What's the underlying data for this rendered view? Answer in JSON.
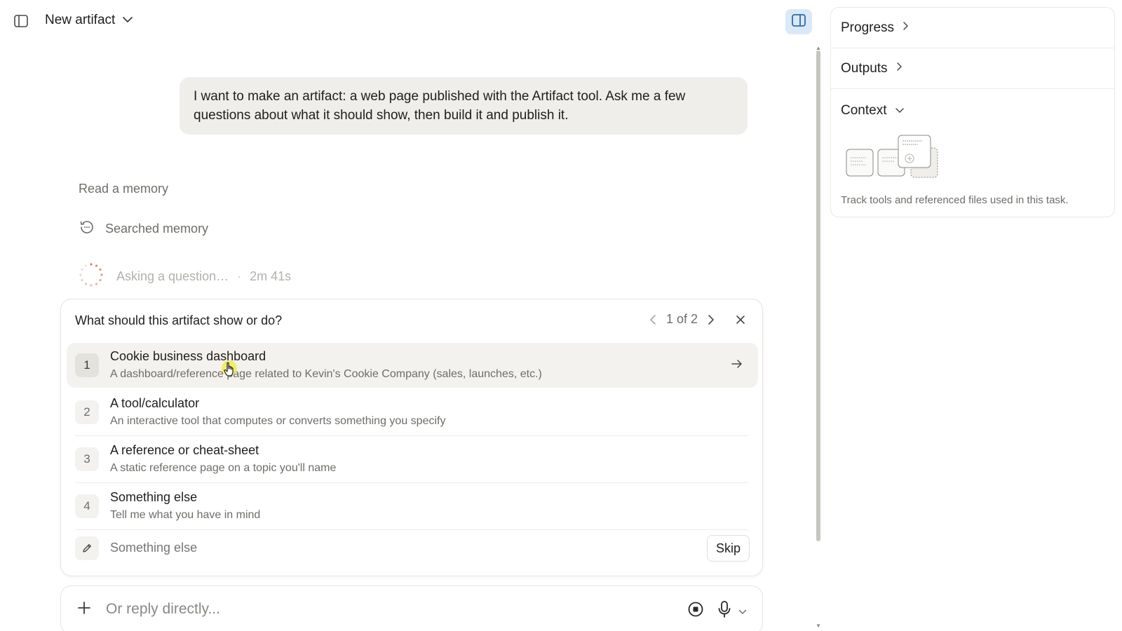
{
  "header": {
    "title": "New artifact"
  },
  "chat": {
    "user_message": "I want to make an artifact: a web page published with the Artifact tool. Ask me a few questions about what it should show, then build it and publish it.",
    "tool_group_label": "Read a memory",
    "tool_step": "Searched memory",
    "status_text": "Asking a question…",
    "status_separator": "·",
    "status_time": "2m 41s"
  },
  "question": {
    "title": "What should this artifact show or do?",
    "pager": "1 of 2",
    "options": [
      {
        "num": "1",
        "label": "Cookie business dashboard",
        "desc": "A dashboard/reference page related to Kevin's Cookie Company (sales, launches, etc.)"
      },
      {
        "num": "2",
        "label": "A tool/calculator",
        "desc": "An interactive tool that computes or converts something you specify"
      },
      {
        "num": "3",
        "label": "A reference or cheat-sheet",
        "desc": "A static reference page on a topic you'll name"
      },
      {
        "num": "4",
        "label": "Something else",
        "desc": "Tell me what you have in mind"
      }
    ],
    "other_placeholder": "Something else",
    "skip_label": "Skip"
  },
  "reply": {
    "placeholder": "Or reply directly..."
  },
  "panel": {
    "progress_label": "Progress",
    "outputs_label": "Outputs",
    "context_label": "Context",
    "context_hint": "Track tools and referenced files used in this task."
  },
  "icons": {
    "sidebar": "sidebar-toggle-icon",
    "title_chevron": "chevron-down-icon",
    "panel": "panel-toggle-icon",
    "memory": "history-icon",
    "spinner": "spinner-icon",
    "prev": "chevron-left-icon",
    "next": "chevron-right-icon",
    "close": "close-icon",
    "arrow": "arrow-right-icon",
    "pencil": "pencil-icon",
    "plus": "plus-icon",
    "stop": "stop-icon",
    "mic": "microphone-icon"
  },
  "colors": {
    "accent_panel_toggle": "#dbe8f6",
    "user_bubble": "#efeeeb",
    "spinner": "#d4806a"
  }
}
